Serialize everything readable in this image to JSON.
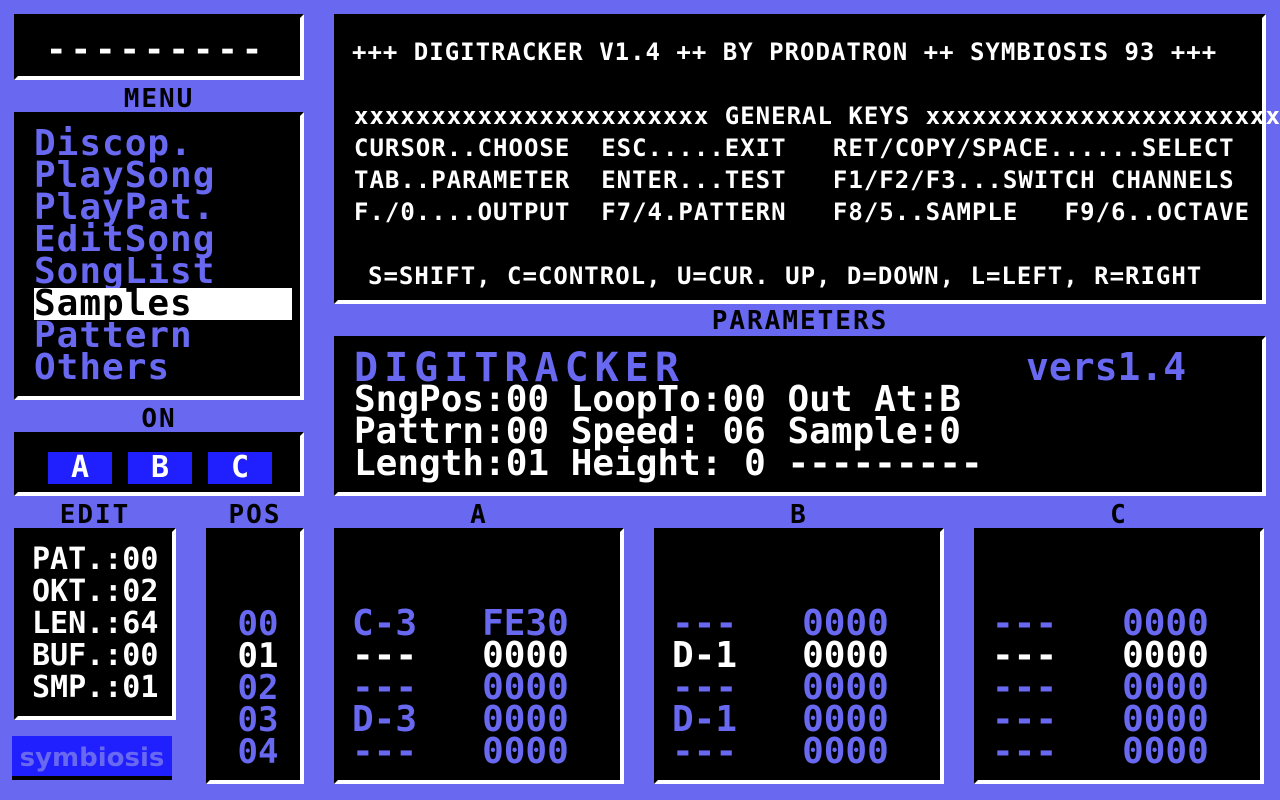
{
  "top_dashes": "---------",
  "headers": {
    "menu": "MENU",
    "on": "ON",
    "parameters": "PARAMETERS",
    "edit": "EDIT",
    "pos": "POS",
    "chan_a": "A",
    "chan_b": "B",
    "chan_c": "C"
  },
  "menu": {
    "items": [
      {
        "label": "Discop."
      },
      {
        "label": "PlaySong"
      },
      {
        "label": "PlayPat."
      },
      {
        "label": "EditSong"
      },
      {
        "label": "SongList"
      },
      {
        "label": "Samples"
      },
      {
        "label": "Pattern"
      },
      {
        "label": "Others"
      }
    ],
    "selected": "Samples"
  },
  "channels_on": {
    "a": "A",
    "b": "B",
    "c": "C"
  },
  "info": {
    "banner": "+++ DIGITRACKER V1.4 ++ BY PRODATRON ++ SYMBIOSIS 93 +++",
    "general_keys": "xxxxxxxxxxxxxxxxxxxxxxx GENERAL KEYS xxxxxxxxxxxxxxxxxxxxxxx",
    "row1": "CURSOR..CHOOSE  ESC.....EXIT   RET/COPY/SPACE......SELECT",
    "row2": "TAB..PARAMETER  ENTER...TEST   F1/F2/F3...SWITCH CHANNELS",
    "row3": "F./0....OUTPUT  F7/4.PATTERN   F8/5..SAMPLE   F9/6..OCTAVE",
    "legend": "S=SHIFT, C=CONTROL, U=CUR. UP, D=DOWN, L=LEFT, R=RIGHT"
  },
  "parameters": {
    "logo": "DIGITRACKER",
    "version": "vers1.4",
    "line1": "SngPos:00 LoopTo:00 Out At:B",
    "line2": "Pattrn:00 Speed: 06 Sample:0",
    "line3": "Length:01 Height: 0 ---------"
  },
  "edit": {
    "pat": "PAT.:00",
    "okt": "OKT.:02",
    "len": "LEN.:64",
    "buf": "BUF.:00",
    "smp": "SMP.:01"
  },
  "pos": [
    "00",
    "01",
    "02",
    "03",
    "04"
  ],
  "channel_a": [
    {
      "note": "C-3",
      "val": "FE30"
    },
    {
      "note": "---",
      "val": "0000"
    },
    {
      "note": "---",
      "val": "0000"
    },
    {
      "note": "D-3",
      "val": "0000"
    },
    {
      "note": "---",
      "val": "0000"
    }
  ],
  "channel_b": [
    {
      "note": "---",
      "val": "0000"
    },
    {
      "note": "D-1",
      "val": "0000"
    },
    {
      "note": "---",
      "val": "0000"
    },
    {
      "note": "D-1",
      "val": "0000"
    },
    {
      "note": "---",
      "val": "0000"
    }
  ],
  "channel_c": [
    {
      "note": "---",
      "val": "0000"
    },
    {
      "note": "---",
      "val": "0000"
    },
    {
      "note": "---",
      "val": "0000"
    },
    {
      "note": "---",
      "val": "0000"
    },
    {
      "note": "---",
      "val": "0000"
    }
  ],
  "logo_text": "symbiosis",
  "colors": {
    "background": "#6868f0",
    "panel": "#000000",
    "highlight": "#ffffff",
    "button": "#2020ff"
  }
}
